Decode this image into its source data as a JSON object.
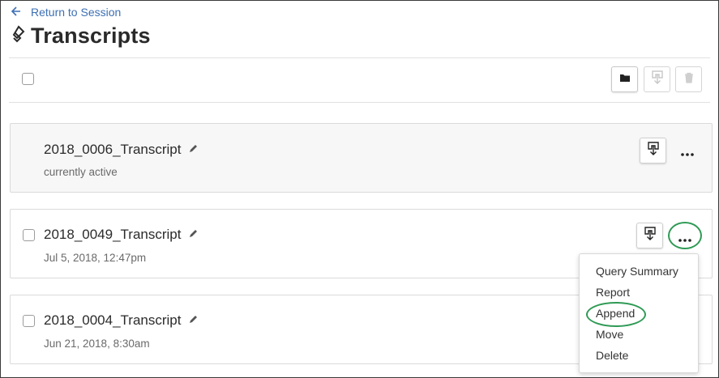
{
  "nav": {
    "back_icon": "arrow-left-icon",
    "back_label": "Return to Session"
  },
  "page": {
    "title_icon": "transcript-icon",
    "title": "Transcripts"
  },
  "toolbar": {
    "icons": [
      "folder-icon",
      "download-icon",
      "trash-icon"
    ]
  },
  "transcripts": [
    {
      "name": "2018_0006_Transcript",
      "subtitle": "currently active",
      "active": true
    },
    {
      "name": "2018_0049_Transcript",
      "subtitle": "Jul 5, 2018, 12:47pm",
      "active": false
    },
    {
      "name": "2018_0004_Transcript",
      "subtitle": "Jun 21, 2018, 8:30am",
      "active": false
    }
  ],
  "context_menu": {
    "items": [
      "Query Summary",
      "Report",
      "Append",
      "Move",
      "Delete"
    ],
    "highlighted": "Append"
  },
  "colors": {
    "link": "#3c6fb4",
    "highlight_circle": "#2f9a55",
    "active_card_bg": "#f7f7f7"
  }
}
